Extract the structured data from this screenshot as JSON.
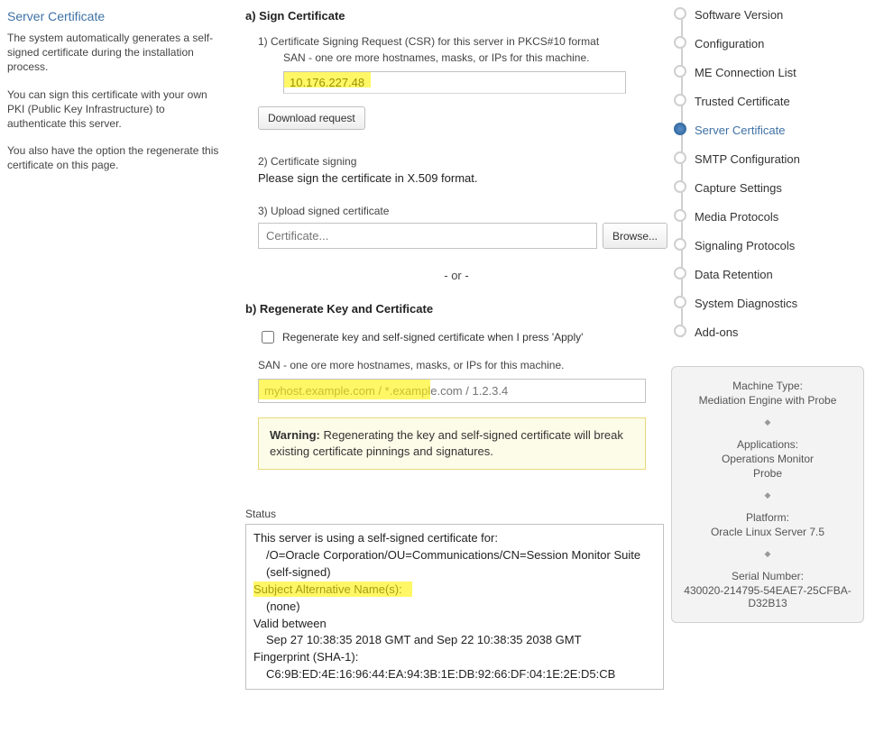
{
  "left": {
    "title": "Server Certificate",
    "p1": "The system automatically generates a self-signed certificate during the installation process.",
    "p2": "You can sign this certificate with your own PKI (Public Key Infrastructure) to authenticate this server.",
    "p3": "You also have the option the regenerate this certificate on this page."
  },
  "sectionA": {
    "title": "a) Sign Certificate",
    "step1_label": "1) Certificate Signing Request (CSR) for this server in PKCS#10 format",
    "san_label": "SAN - one ore more hostnames, masks, or IPs for this machine.",
    "san_value": "10.176.227.48",
    "download_btn": "Download request",
    "step2_label": "2) Certificate signing",
    "step2_text": "Please sign the certificate in X.509 format.",
    "step3_label": "3) Upload signed certificate",
    "cert_placeholder": "Certificate...",
    "browse_btn": "Browse...",
    "or_sep": "- or -"
  },
  "sectionB": {
    "title": "b) Regenerate Key and Certificate",
    "checkbox_label": "Regenerate key and self-signed certificate when I press 'Apply'",
    "san_label": "SAN - one ore more hostnames, masks, or IPs for this machine.",
    "san_placeholder": "myhost.example.com / *.example.com / 1.2.3.4",
    "warn_bold": "Warning:",
    "warn_text": " Regenerating the key and self-signed certificate will break existing certificate pinnings and signatures."
  },
  "status": {
    "label": "Status",
    "l1": "This server is using a self-signed certificate for:",
    "l2": "/O=Oracle Corporation/OU=Communications/CN=Session Monitor Suite (self-signed)",
    "l3": "Subject Alternative Name(s):",
    "l4": "(none)",
    "l5": "Valid between",
    "l6": "Sep 27 10:38:35 2018 GMT and Sep 22 10:38:35 2038 GMT",
    "l7": "Fingerprint (SHA-1):",
    "l8": "C6:9B:ED:4E:16:96:44:EA:94:3B:1E:DB:92:66:DF:04:1E:2E:D5:CB"
  },
  "nav": {
    "items": [
      "Software Version",
      "Configuration",
      "ME Connection List",
      "Trusted Certificate",
      "Server Certificate",
      "SMTP Configuration",
      "Capture Settings",
      "Media Protocols",
      "Signaling Protocols",
      "Data Retention",
      "System Diagnostics",
      "Add-ons"
    ],
    "active_index": 4
  },
  "info": {
    "machine_type_k": "Machine Type:",
    "machine_type_v": "Mediation Engine with Probe",
    "apps_k": "Applications:",
    "apps_v1": "Operations Monitor",
    "apps_v2": "Probe",
    "platform_k": "Platform:",
    "platform_v": "Oracle Linux Server 7.5",
    "serial_k": "Serial Number:",
    "serial_v": "430020-214795-54EAE7-25CFBA-D32B13"
  }
}
